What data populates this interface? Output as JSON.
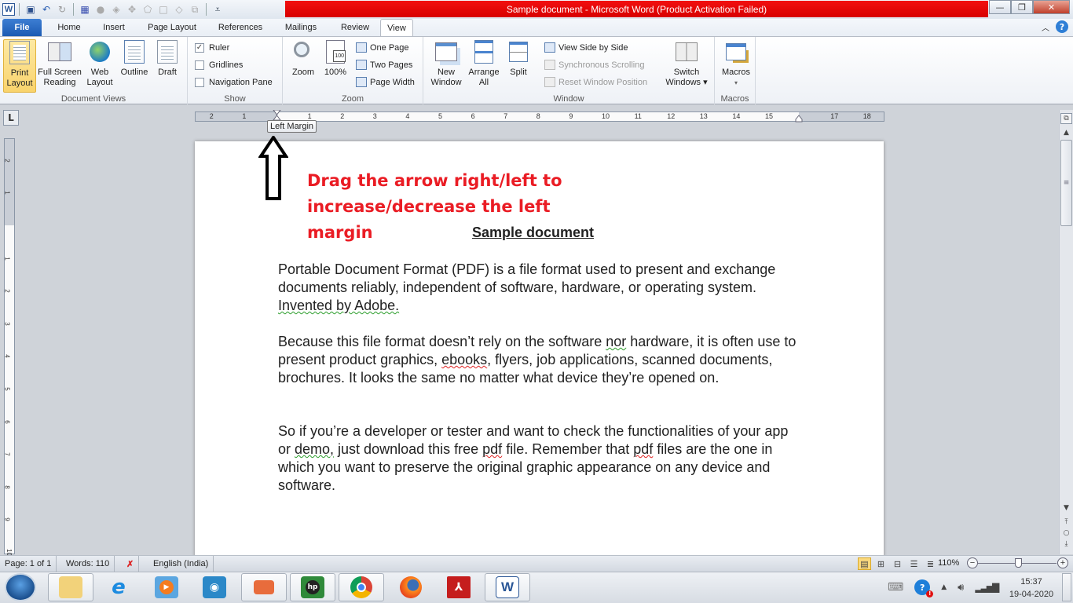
{
  "window": {
    "title": "Sample document  -  Microsoft Word (Product Activation Failed)",
    "title_bar_color": "#e00a0a",
    "controls": {
      "minimize": "—",
      "restore": "❐",
      "close": "✕"
    }
  },
  "quick_access": {
    "icons": [
      "word-logo-icon",
      "save-icon",
      "undo-icon",
      "redo-icon",
      "table-grid-icon",
      "shape-icon",
      "fill-icon",
      "position-icon",
      "edit-shape-icon",
      "border-icon",
      "shading-icon",
      "arrange-icon",
      "customize-icon"
    ],
    "word_logo": "W"
  },
  "tabs": [
    {
      "label": "File"
    },
    {
      "label": "Home"
    },
    {
      "label": "Insert"
    },
    {
      "label": "Page Layout"
    },
    {
      "label": "References"
    },
    {
      "label": "Mailings"
    },
    {
      "label": "Review"
    },
    {
      "label": "View",
      "active": true
    }
  ],
  "ribbon": {
    "document_views": {
      "label": "Document Views",
      "buttons": [
        {
          "label1": "Print",
          "label2": "Layout",
          "selected": true
        },
        {
          "label1": "Full Screen",
          "label2": "Reading"
        },
        {
          "label1": "Web",
          "label2": "Layout"
        },
        {
          "label1": "Outline",
          "label2": ""
        },
        {
          "label1": "Draft",
          "label2": ""
        }
      ]
    },
    "show": {
      "label": "Show",
      "checks": [
        {
          "label": "Ruler",
          "checked": true,
          "mark": "✓"
        },
        {
          "label": "Gridlines",
          "checked": false
        },
        {
          "label": "Navigation Pane",
          "checked": false
        }
      ]
    },
    "zoom": {
      "label": "Zoom",
      "zoom_btn": "Zoom",
      "hundred_btn": "100%",
      "hundred_badge": "100",
      "small": [
        "One Page",
        "Two Pages",
        "Page Width"
      ]
    },
    "window": {
      "label": "Window",
      "new_window": [
        "New",
        "Window"
      ],
      "arrange_all": [
        "Arrange",
        "All"
      ],
      "split": "Split",
      "small": [
        {
          "label": "View Side by Side",
          "enabled": true
        },
        {
          "label": "Synchronous Scrolling",
          "enabled": false
        },
        {
          "label": "Reset Window Position",
          "enabled": false
        }
      ],
      "switch_windows": [
        "Switch",
        "Windows ▾"
      ]
    },
    "macros": {
      "label": "Macros",
      "button": "Macros",
      "arrow": "▾"
    }
  },
  "ruler": {
    "tab_selector": "L",
    "tooltip": "Left Margin",
    "h_numbers": [
      "2",
      "1",
      "1",
      "2",
      "3",
      "4",
      "5",
      "6",
      "7",
      "8",
      "9",
      "10",
      "11",
      "12",
      "13",
      "14",
      "15",
      "17",
      "18"
    ],
    "v_numbers": [
      "2",
      "1",
      "1",
      "2",
      "3",
      "4",
      "5",
      "6",
      "7",
      "8",
      "9",
      "10"
    ]
  },
  "document": {
    "instruction": "Drag the arrow right/left to increase/decrease the left margin",
    "instruction_color": "#ea1c24",
    "title": "Sample document",
    "p1": {
      "a": "Portable Document Format (PDF) is a file format used to present and exchange documents reliably, independent of software, hardware, or operating system. ",
      "b": "Invented by Adobe."
    },
    "p2": {
      "a": "Because this file format doesn’t rely on the software ",
      "nor": "nor",
      "b": " hardware, it is often use to present product graphics, ",
      "ebooks": "ebooks",
      "c": ", flyers, job applications, scanned documents, brochures. It looks the same no matter what device they’re opened on."
    },
    "p3": {
      "a": "So if you’re a developer or tester and want to check the functionalities of your app or ",
      "demo": "demo,",
      "b": " just download this free ",
      "pdf1": "pdf",
      "c": " file. Remember that ",
      "pdf2": "pdf",
      "d": " files are the one in which you want to preserve the original graphic appearance on any device and software."
    }
  },
  "statusbar": {
    "page": "Page: 1 of 1",
    "words": "Words: 110",
    "language": "English (India)",
    "zoom": "110%",
    "zoom_level_percent": 110,
    "view_buttons": [
      "print-layout",
      "full-screen-reading",
      "web-layout",
      "outline",
      "draft"
    ]
  },
  "taskbar": {
    "apps": [
      "File Explorer",
      "Internet Explorer",
      "Windows Media Player",
      "Fish app",
      "Presentation app",
      "HP Support",
      "Google Chrome",
      "Firefox",
      "Adobe Reader",
      "Microsoft Word"
    ],
    "time": "15:37",
    "date": "19-04-2020"
  }
}
